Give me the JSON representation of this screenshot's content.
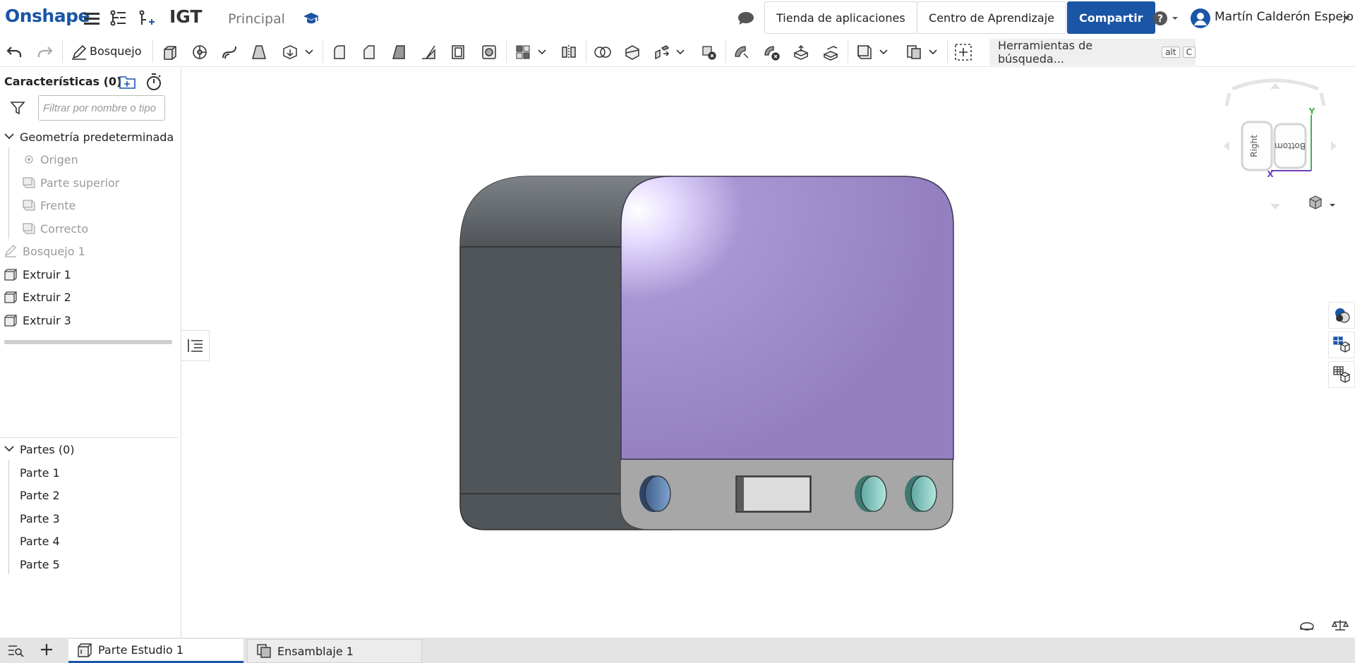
{
  "header": {
    "logo": "Onshape",
    "document_title": "IGT",
    "workspace": "Principal",
    "app_store_label": "Tienda de aplicaciones",
    "learning_center_label": "Centro de Aprendizaje",
    "share_label": "Compartir",
    "user_name": "Martín Calderón Espejo",
    "accent_color": "#1a55a6"
  },
  "toolbar": {
    "sketch_label": "Bosquejo",
    "search_tools_label": "Herramientas de búsqueda...",
    "search_shortcut_alt": "alt",
    "search_shortcut_key": "C"
  },
  "feature_panel": {
    "header": "Características (0)",
    "filter_placeholder": "Filtrar por nombre o tipo",
    "default_geometry_label": "Geometría predeterminada",
    "default_geometry_items": [
      "Origen",
      "Parte superior",
      "Frente",
      "Correcto"
    ],
    "features": [
      "Bosquejo 1",
      "Extruir 1",
      "Extruir 2",
      "Extruir 3"
    ]
  },
  "parts_panel": {
    "header": "Partes (0)",
    "items": [
      "Parte 1",
      "Parte 2",
      "Parte 3",
      "Parte 4",
      "Parte 5"
    ]
  },
  "view_cube": {
    "face_right": "Right",
    "face_bottom": "Bottom",
    "axis_y": "Y",
    "axis_x": "X"
  },
  "tabs": {
    "part_studio": "Parte Estudio 1",
    "assembly": "Ensamblaje 1"
  }
}
